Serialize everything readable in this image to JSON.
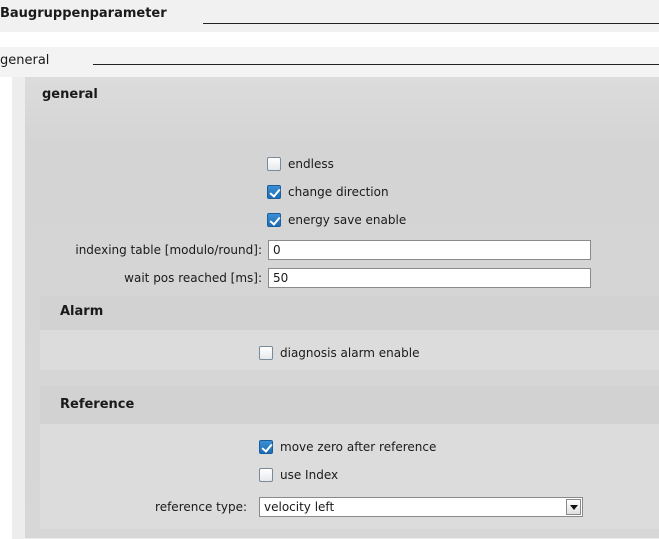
{
  "header": {
    "title": "Baugruppenparameter"
  },
  "section": {
    "title": "general"
  },
  "general_panel": {
    "title": "general",
    "checkboxes": {
      "endless": {
        "label": "endless",
        "checked": false
      },
      "change_direction": {
        "label": "change direction",
        "checked": true
      },
      "energy_save": {
        "label": "energy save enable",
        "checked": true
      }
    },
    "fields": {
      "indexing_table": {
        "label": "indexing table [modulo/round]:",
        "value": "0"
      },
      "wait_pos": {
        "label": "wait pos reached [ms]:",
        "value": "50"
      }
    }
  },
  "alarm_panel": {
    "title": "Alarm",
    "checkboxes": {
      "diagnosis_alarm": {
        "label": "diagnosis alarm enable",
        "checked": false
      }
    }
  },
  "reference_panel": {
    "title": "Reference",
    "checkboxes": {
      "move_zero": {
        "label": "move zero after reference",
        "checked": true
      },
      "use_index": {
        "label": "use Index",
        "checked": false
      }
    },
    "reference_type": {
      "label": "reference type:",
      "selected": "velocity left"
    }
  },
  "colors": {
    "checkbox_checked": "#1e6db5",
    "panel_bg": "#d7d7d7",
    "subpanel_bg": "#dcdcdc"
  }
}
